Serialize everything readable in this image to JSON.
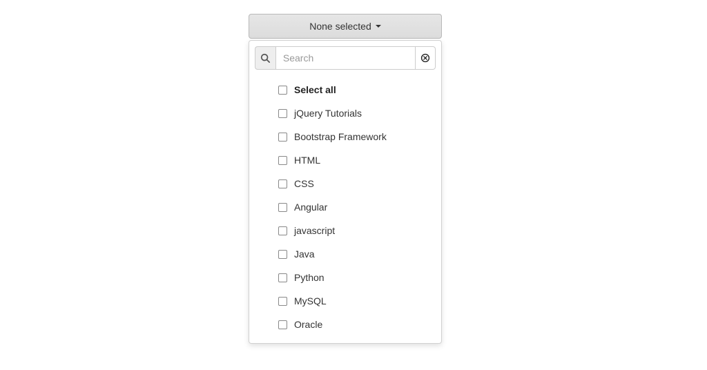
{
  "dropdown": {
    "button_label": "None selected",
    "search": {
      "placeholder": "Search",
      "value": ""
    },
    "select_all_label": "Select all",
    "options": [
      "jQuery Tutorials",
      "Bootstrap Framework",
      "HTML",
      "CSS",
      "Angular",
      "javascript",
      "Java",
      "Python",
      "MySQL",
      "Oracle"
    ]
  }
}
